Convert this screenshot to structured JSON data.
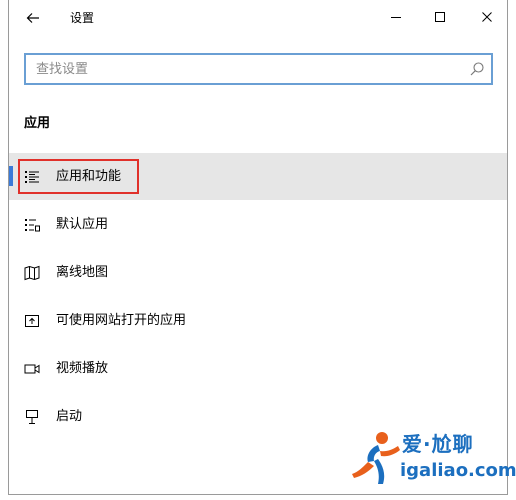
{
  "window": {
    "title": "设置",
    "controls": {
      "minimize": "minimize",
      "maximize": "maximize",
      "close": "close"
    }
  },
  "search": {
    "placeholder": "查找设置",
    "value": ""
  },
  "section": {
    "title": "应用"
  },
  "nav": {
    "items": [
      {
        "label": "应用和功能",
        "icon": "apps-features-icon",
        "selected": true
      },
      {
        "label": "默认应用",
        "icon": "default-apps-icon",
        "selected": false
      },
      {
        "label": "离线地图",
        "icon": "offline-maps-icon",
        "selected": false
      },
      {
        "label": "可使用网站打开的应用",
        "icon": "apps-for-websites-icon",
        "selected": false
      },
      {
        "label": "视频播放",
        "icon": "video-playback-icon",
        "selected": false
      },
      {
        "label": "启动",
        "icon": "startup-icon",
        "selected": false
      }
    ]
  },
  "colors": {
    "accent": "#3a7ad8",
    "highlight_border": "#e0302a",
    "selected_bg": "#e6e6e6",
    "watermark": "#1c6fbf"
  },
  "watermark": {
    "brand": "爱·尬聊",
    "url": "igaliao.com"
  }
}
